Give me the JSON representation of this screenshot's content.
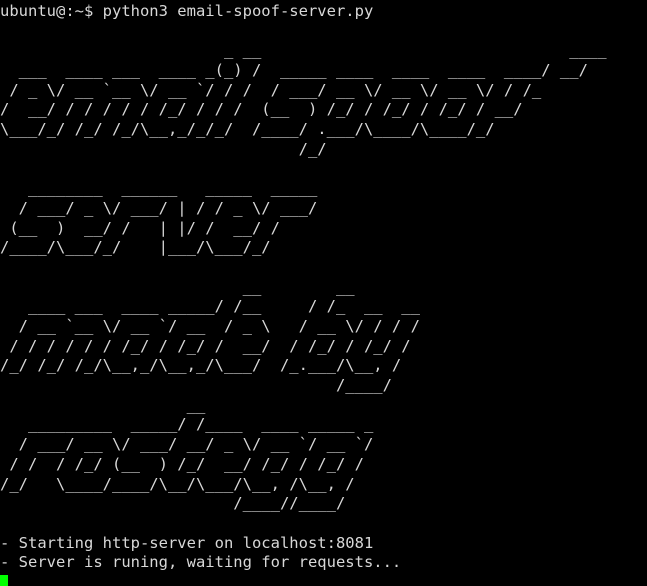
{
  "theme": {
    "background": "#000000",
    "foreground": "#d8d8d8",
    "cursor_color": "#00ff00"
  },
  "prompt": "ubuntu@:~$ python3 email-spoof-server.py",
  "banner": [
    "",
    "                        _ __                                 ____",
    "  ___  ____ ___  ____ _(_) /  _____ ____  ____  ____  ____/ __/",
    " / _ \\/ __ `__ \\/ __ `/ / /  / ___/ __ \\/ __ \\/ __ \\/ / /_",
    "/  __/ / / / / / /_/ / / /  (__  ) /_/ / /_/ / /_/ / __/",
    "\\___/_/ /_/ /_/\\__,_/_/_/  /____/ .___/\\____/\\____/_/",
    "                                /_/",
    "",
    "   ________  ______   _____  _____",
    "  / ___/ _ \\/ ___/ | / / _ \\/ ___/",
    " (__  )  __/ /   | |/ /  __/ /",
    "/____/\\___/_/    |___/\\___/_/",
    "",
    "                          __        __",
    "   ____ ___  ____ _____/ /__     / /_  __  __",
    "  / __ `__ \\/ __ `/ __  / _ \\   / __ \\/ / / /",
    " / / / / / / /_/ / /_/ /  __/  / /_/ / /_/ /",
    "/_/ /_/ /_/\\__,_/\\__,_/\\___/  /_.___/\\__, /",
    "                                    /____/",
    "                    __",
    "   _________  _____/ /____  ____ _____ _",
    "  / ___/ __ \\/ ___/ __/ _ \\/ __ `/ __ `/",
    " / /  / /_/ (__  ) /_/  __/ /_/ / /_/ /",
    "/_/   \\____/____/\\__/\\___/\\__, /\\__, /",
    "                         /____//____/",
    ""
  ],
  "log_lines": [
    "- Starting http-server on localhost:8081",
    "- Server is runing, waiting for requests..."
  ]
}
